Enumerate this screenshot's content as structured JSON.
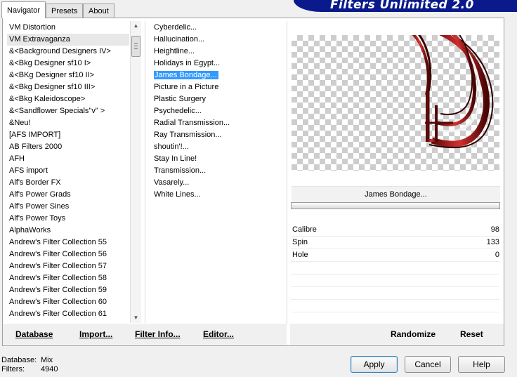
{
  "tabs": [
    "Navigator",
    "Presets",
    "About"
  ],
  "banner_title": "Filters Unlimited 2.0",
  "categories": [
    "VM Distortion",
    "VM Extravaganza",
    "&<Background Designers IV>",
    "&<Bkg Designer sf10 I>",
    "&<BKg Designer sf10 II>",
    "&<Bkg Designer sf10 III>",
    "&<Bkg Kaleidoscope>",
    "&<Sandflower Specials\"v\" >",
    "&Neu!",
    "[AFS IMPORT]",
    "AB Filters 2000",
    "AFH",
    "AFS import",
    "Alf's Border FX",
    "Alf's Power Grads",
    "Alf's Power Sines",
    "Alf's Power Toys",
    "AlphaWorks",
    "Andrew's Filter Collection 55",
    "Andrew's Filter Collection 56",
    "Andrew's Filter Collection 57",
    "Andrew's Filter Collection 58",
    "Andrew's Filter Collection 59",
    "Andrew's Filter Collection 60",
    "Andrew's Filter Collection 61"
  ],
  "filters": [
    "Cyberdelic...",
    "Hallucination...",
    "Heightline...",
    "Holidays in Egypt...",
    "James Bondage...",
    "Picture in a Picture",
    "Plastic Surgery",
    "Psychedelic...",
    "Radial Transmission...",
    "Ray Transmission...",
    "shoutin'!...",
    "Stay In Line!",
    "Transmission...",
    "Vasarely...",
    "White Lines..."
  ],
  "selected_filter": "James Bondage...",
  "params": [
    {
      "label": "Calibre",
      "value": "98"
    },
    {
      "label": "Spin",
      "value": "133"
    },
    {
      "label": "Hole",
      "value": "0"
    }
  ],
  "toolbar": {
    "database": "Database",
    "import": "Import...",
    "filter_info": "Filter Info...",
    "editor": "Editor...",
    "randomize": "Randomize",
    "reset": "Reset"
  },
  "status": {
    "database_label": "Database:",
    "database_value": "Mix",
    "filters_label": "Filters:",
    "filters_value": "4940"
  },
  "buttons": {
    "apply": "Apply",
    "cancel": "Cancel",
    "help": "Help"
  },
  "colors": {
    "selection": "#3399ff",
    "banner": "#0a1a8c",
    "preview_ring": "#8b1010"
  }
}
